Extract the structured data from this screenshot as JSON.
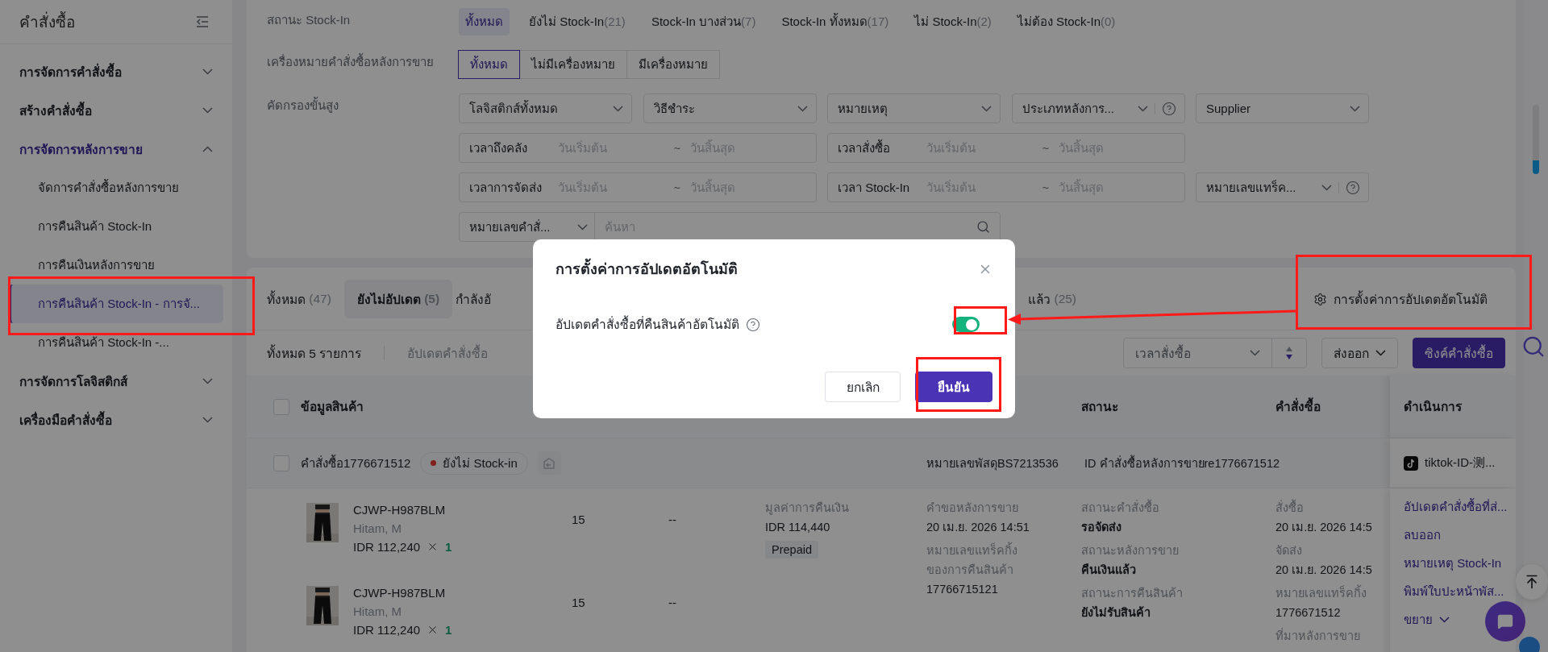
{
  "sidebar": {
    "title": "คำสั่งซื้อ",
    "groups": [
      {
        "label": "การจัดการคำสั่งซื้อ",
        "expanded": false
      },
      {
        "label": "สร้างคำสั่งซื้อ",
        "expanded": false
      },
      {
        "label": "การจัดการหลังการขาย",
        "expanded": true,
        "children": [
          {
            "label": "จัดการคำสั่งซื้อหลังการขาย",
            "selected": false
          },
          {
            "label": "การคืนสินค้า Stock-In",
            "selected": false
          },
          {
            "label": "การคืนเงินหลังการขาย",
            "selected": false
          },
          {
            "label": "การคืนสินค้า Stock-In - การจั...",
            "selected": true
          },
          {
            "label": "การคืนสินค้า Stock-In -...",
            "selected": false
          }
        ]
      },
      {
        "label": "การจัดการโลจิสติกส์",
        "expanded": false
      },
      {
        "label": "เครื่องมือคำสั่งซื้อ",
        "expanded": false
      }
    ]
  },
  "filters": {
    "stock_in_status": {
      "label": "สถานะ Stock-In",
      "options": [
        {
          "label": "ทั้งหมด",
          "selected": true
        },
        {
          "label": "ยังไม่ Stock-In",
          "count": "(21)",
          "selected": false
        },
        {
          "label": "Stock-In บางส่วน",
          "count": "(7)",
          "selected": false
        },
        {
          "label": "Stock-In ทั้งหมด",
          "count": "(17)",
          "selected": false
        },
        {
          "label": "ไม่ Stock-In",
          "count": "(2)",
          "selected": false
        },
        {
          "label": "ไม่ต้อง Stock-In",
          "count": "(0)",
          "selected": false
        }
      ]
    },
    "after_sale_marker": {
      "label": "เครื่องหมายคำสั่งซื้อหลังการขาย",
      "options": [
        {
          "label": "ทั้งหมด",
          "selected": true
        },
        {
          "label": "ไม่มีเครื่องหมาย",
          "selected": false
        },
        {
          "label": "มีเครื่องหมาย",
          "selected": false
        }
      ]
    },
    "advanced": {
      "label": "คัดกรองขั้นสูง",
      "fields": [
        {
          "kind": "select",
          "label": "โลจิสติกส์ทั้งหมด",
          "help": false
        },
        {
          "kind": "select",
          "label": "วิธีชำระ",
          "help": false
        },
        {
          "kind": "select",
          "label": "หมายเหตุ",
          "help": false
        },
        {
          "kind": "select",
          "label": "ประเภทหลังการ...",
          "help": true
        },
        {
          "kind": "select",
          "label": "Supplier",
          "help": false
        },
        {
          "kind": "date_range",
          "label": "เวลาถึงคลัง",
          "start": "วันเริ่มต้น",
          "separator": "~",
          "end": "วันสิ้นสุด"
        },
        {
          "kind": "date_range",
          "label": "เวลาสั่งซื้อ",
          "start": "วันเริ่มต้น",
          "separator": "~",
          "end": "วันสิ้นสุด"
        },
        {
          "kind": "date_range",
          "label": "เวลาการจัดส่ง",
          "start": "วันเริ่มต้น",
          "separator": "~",
          "end": "วันสิ้นสุด"
        },
        {
          "kind": "date_range",
          "label": "เวลา Stock-In",
          "start": "วันเริ่มต้น",
          "separator": "~",
          "end": "วันสิ้นสุด"
        },
        {
          "kind": "select",
          "label": "หมายเลขแทร็ค...",
          "help": true
        },
        {
          "kind": "search",
          "label": "หมายเลขคำสั่...",
          "placeholder": "ค้นหา"
        }
      ]
    }
  },
  "tabs": [
    {
      "label": "ทั้งหมด",
      "count": "(47)",
      "selected": false
    },
    {
      "label": "ยังไม่อัปเดต",
      "count": "(5)",
      "selected": true
    },
    {
      "label": "กำลังอั",
      "selected": false
    },
    {
      "label": "แล้ว",
      "count": "(25)",
      "selected": false
    }
  ],
  "settings_link": "การตั้งค่าการอัปเดตอัตโนมัติ",
  "toolbar": {
    "total": "ทั้งหมด 5 รายการ",
    "bulk_action": "อัปเดตคำสั่งซื้อ",
    "sort": "เวลาสั่งซื้อ",
    "export": "ส่งออก",
    "sync": "ซิงค์คำสั่งซื้อ"
  },
  "table": {
    "header_checked": false,
    "columns": [
      "ข้อมูลสินค้า",
      "สถานะ",
      "คำสั่งซื้อ",
      "ดำเนินการ"
    ],
    "orders": [
      {
        "checked": false,
        "order_no": "คำสั่งซื้อ1776671512",
        "stock_in_badge": "ยังไม่ Stock-in",
        "parcel": "หมายเลขพัสดุBS7213536",
        "after_sale_id": "ID คำสั่งซื้อหลังการขายre1776671512",
        "shop": "tiktok-ID-测...",
        "items": [
          {
            "sku": "CJWP-H987BLM",
            "variant": "Hitam, M",
            "price": "IDR 112,240",
            "quantity": "1",
            "column_3": "15",
            "column_4": "--"
          },
          {
            "sku": "CJWP-H987BLM",
            "variant": "Hitam, M",
            "price": "IDR 112,240",
            "quantity": "1",
            "column_3": "15",
            "column_4": "--"
          }
        ],
        "refund": {
          "label": "มูลค่าการคืนเงิน",
          "value": "IDR 114,440",
          "tag": "Prepaid"
        },
        "after_sale": [
          {
            "label": "คำขอหลังการขาย",
            "value": "20 เม.ย. 2026 14:51"
          },
          {
            "label": "หมายเลขแทร็คกิ้งของการคืนสินค้า",
            "value": "17766715121"
          }
        ],
        "status": [
          {
            "label": "สถานะคำสั่งซื้อ",
            "value": "รอจัดส่ง"
          },
          {
            "label": "สถานะหลังการขาย",
            "value": "คืนเงินแล้ว"
          },
          {
            "label": "สถานะการคืนสินค้า",
            "value": "ยังไม่รับสินค้า"
          }
        ],
        "order_info": [
          {
            "label": "สั่งซื้อ",
            "value": "20 เม.ย. 2026 14:5"
          },
          {
            "label": "จัดส่ง",
            "value": "20 เม.ย. 2026 14:5"
          },
          {
            "label": "หมายเลขแทร็คกิ้ง",
            "value": "1776671512"
          },
          {
            "label": "ที่มาหลังการขาย"
          }
        ],
        "actions": [
          {
            "kind": "link",
            "label": "อัปเดตคำสั่งซื้อที่ส่..."
          },
          {
            "kind": "link",
            "label": "ลบออก"
          },
          {
            "kind": "link",
            "label": "หมายเหตุ Stock-In"
          },
          {
            "kind": "link",
            "label": "พิมพ์ใบปะหน้าพัส..."
          },
          {
            "kind": "expand",
            "label": "ขยาย"
          }
        ]
      }
    ]
  },
  "modal": {
    "title": "การตั้งค่าการอัปเดตอัตโนมัติ",
    "setting": {
      "label": "อัปเดตคำสั่งซื้อที่คืนสินค้าอัตโนมัติ",
      "on": true
    },
    "cancel": "ยกเลิก",
    "confirm": "ยืนยัน"
  }
}
